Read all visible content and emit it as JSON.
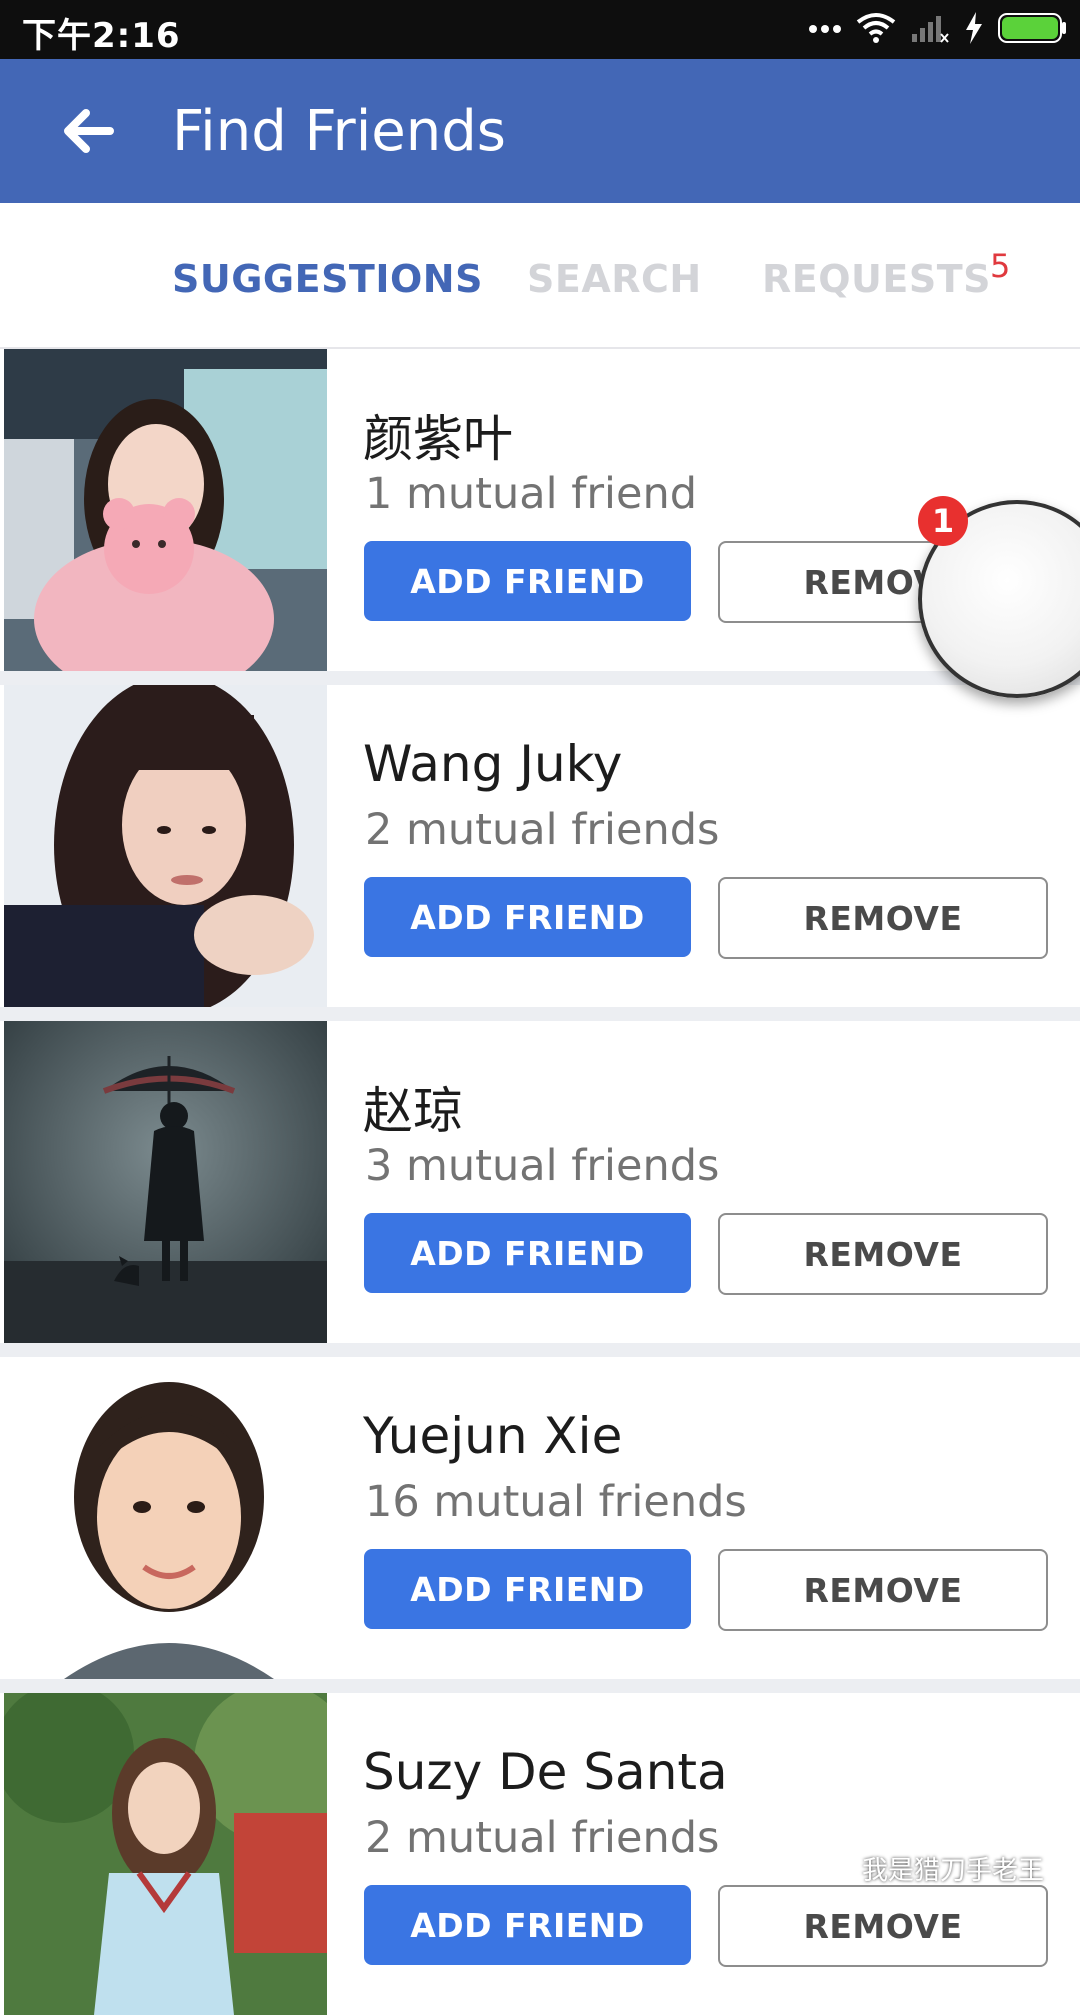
{
  "status_bar": {
    "time": "下午2:16",
    "icons": [
      "more-dots-icon",
      "wifi-icon",
      "signal-icon",
      "charging-icon",
      "battery-icon"
    ]
  },
  "app_bar": {
    "title": "Find Friends",
    "back_icon": "back-arrow-icon",
    "background": "#4367b6"
  },
  "tabs": [
    {
      "label": "SUGGESTIONS",
      "active": true
    },
    {
      "label": "SEARCH",
      "active": false
    },
    {
      "label": "REQUESTS",
      "active": false,
      "count": "5"
    }
  ],
  "suggestions": [
    {
      "name": "颜紫叶",
      "mutual": "1 mutual friend",
      "add_label": "ADD FRIEND",
      "remove_label": "REMOVE"
    },
    {
      "name": "Wang Juky",
      "mutual": "2 mutual friends",
      "add_label": "ADD FRIEND",
      "remove_label": "REMOVE"
    },
    {
      "name": "赵琼",
      "mutual": "3 mutual friends",
      "add_label": "ADD FRIEND",
      "remove_label": "REMOVE"
    },
    {
      "name": "Yuejun Xie",
      "mutual": "16 mutual friends",
      "add_label": "ADD FRIEND",
      "remove_label": "REMOVE"
    },
    {
      "name": "Suzy De Santa",
      "mutual": "2 mutual friends",
      "add_label": "ADD FRIEND",
      "remove_label": "REMOVE"
    }
  ],
  "floating_button": {
    "badge": "1"
  },
  "watermark": {
    "text": "我是猎刀手老王"
  },
  "colors": {
    "accent": "#3a75e3",
    "active_tab": "#4367b6",
    "badge_red": "#e0393e"
  }
}
